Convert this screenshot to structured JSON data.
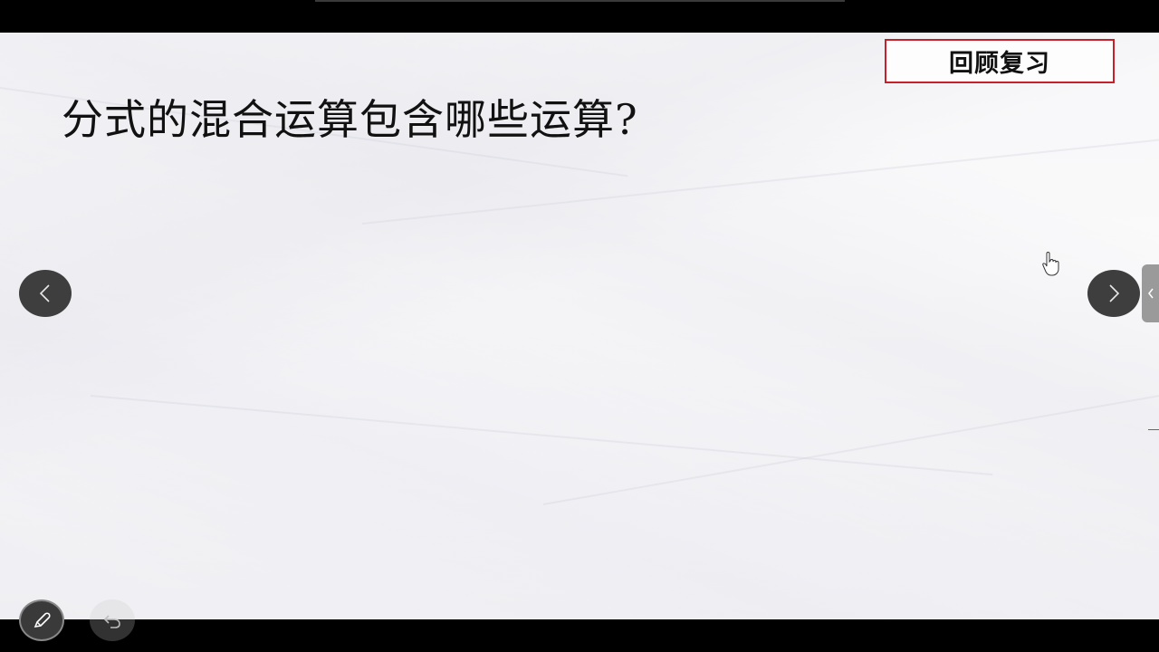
{
  "slide": {
    "question": "分式的混合运算包含哪些运算?",
    "review_label": "回顾复习"
  },
  "navigation": {
    "prev_icon": "chevron-left-icon",
    "next_icon": "chevron-right-icon",
    "side_tab_icon": "chevron-left-icon"
  },
  "toolbar": {
    "pen_icon": "pen-icon",
    "undo_icon": "undo-icon"
  },
  "colors": {
    "review_border": "#c8202a",
    "nav_button": "#3e3e3e"
  }
}
